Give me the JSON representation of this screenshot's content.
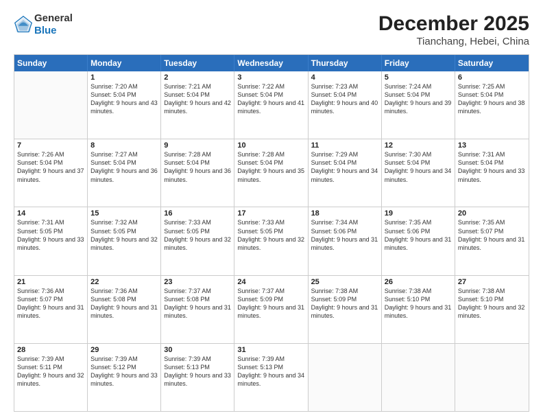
{
  "header": {
    "logo_line1": "General",
    "logo_line2": "Blue",
    "title": "December 2025",
    "subtitle": "Tianchang, Hebei, China"
  },
  "weekdays": [
    "Sunday",
    "Monday",
    "Tuesday",
    "Wednesday",
    "Thursday",
    "Friday",
    "Saturday"
  ],
  "weeks": [
    [
      {
        "day": "",
        "sunrise": "",
        "sunset": "",
        "daylight": ""
      },
      {
        "day": "1",
        "sunrise": "Sunrise: 7:20 AM",
        "sunset": "Sunset: 5:04 PM",
        "daylight": "Daylight: 9 hours and 43 minutes."
      },
      {
        "day": "2",
        "sunrise": "Sunrise: 7:21 AM",
        "sunset": "Sunset: 5:04 PM",
        "daylight": "Daylight: 9 hours and 42 minutes."
      },
      {
        "day": "3",
        "sunrise": "Sunrise: 7:22 AM",
        "sunset": "Sunset: 5:04 PM",
        "daylight": "Daylight: 9 hours and 41 minutes."
      },
      {
        "day": "4",
        "sunrise": "Sunrise: 7:23 AM",
        "sunset": "Sunset: 5:04 PM",
        "daylight": "Daylight: 9 hours and 40 minutes."
      },
      {
        "day": "5",
        "sunrise": "Sunrise: 7:24 AM",
        "sunset": "Sunset: 5:04 PM",
        "daylight": "Daylight: 9 hours and 39 minutes."
      },
      {
        "day": "6",
        "sunrise": "Sunrise: 7:25 AM",
        "sunset": "Sunset: 5:04 PM",
        "daylight": "Daylight: 9 hours and 38 minutes."
      }
    ],
    [
      {
        "day": "7",
        "sunrise": "Sunrise: 7:26 AM",
        "sunset": "Sunset: 5:04 PM",
        "daylight": "Daylight: 9 hours and 37 minutes."
      },
      {
        "day": "8",
        "sunrise": "Sunrise: 7:27 AM",
        "sunset": "Sunset: 5:04 PM",
        "daylight": "Daylight: 9 hours and 36 minutes."
      },
      {
        "day": "9",
        "sunrise": "Sunrise: 7:28 AM",
        "sunset": "Sunset: 5:04 PM",
        "daylight": "Daylight: 9 hours and 36 minutes."
      },
      {
        "day": "10",
        "sunrise": "Sunrise: 7:28 AM",
        "sunset": "Sunset: 5:04 PM",
        "daylight": "Daylight: 9 hours and 35 minutes."
      },
      {
        "day": "11",
        "sunrise": "Sunrise: 7:29 AM",
        "sunset": "Sunset: 5:04 PM",
        "daylight": "Daylight: 9 hours and 34 minutes."
      },
      {
        "day": "12",
        "sunrise": "Sunrise: 7:30 AM",
        "sunset": "Sunset: 5:04 PM",
        "daylight": "Daylight: 9 hours and 34 minutes."
      },
      {
        "day": "13",
        "sunrise": "Sunrise: 7:31 AM",
        "sunset": "Sunset: 5:04 PM",
        "daylight": "Daylight: 9 hours and 33 minutes."
      }
    ],
    [
      {
        "day": "14",
        "sunrise": "Sunrise: 7:31 AM",
        "sunset": "Sunset: 5:05 PM",
        "daylight": "Daylight: 9 hours and 33 minutes."
      },
      {
        "day": "15",
        "sunrise": "Sunrise: 7:32 AM",
        "sunset": "Sunset: 5:05 PM",
        "daylight": "Daylight: 9 hours and 32 minutes."
      },
      {
        "day": "16",
        "sunrise": "Sunrise: 7:33 AM",
        "sunset": "Sunset: 5:05 PM",
        "daylight": "Daylight: 9 hours and 32 minutes."
      },
      {
        "day": "17",
        "sunrise": "Sunrise: 7:33 AM",
        "sunset": "Sunset: 5:05 PM",
        "daylight": "Daylight: 9 hours and 32 minutes."
      },
      {
        "day": "18",
        "sunrise": "Sunrise: 7:34 AM",
        "sunset": "Sunset: 5:06 PM",
        "daylight": "Daylight: 9 hours and 31 minutes."
      },
      {
        "day": "19",
        "sunrise": "Sunrise: 7:35 AM",
        "sunset": "Sunset: 5:06 PM",
        "daylight": "Daylight: 9 hours and 31 minutes."
      },
      {
        "day": "20",
        "sunrise": "Sunrise: 7:35 AM",
        "sunset": "Sunset: 5:07 PM",
        "daylight": "Daylight: 9 hours and 31 minutes."
      }
    ],
    [
      {
        "day": "21",
        "sunrise": "Sunrise: 7:36 AM",
        "sunset": "Sunset: 5:07 PM",
        "daylight": "Daylight: 9 hours and 31 minutes."
      },
      {
        "day": "22",
        "sunrise": "Sunrise: 7:36 AM",
        "sunset": "Sunset: 5:08 PM",
        "daylight": "Daylight: 9 hours and 31 minutes."
      },
      {
        "day": "23",
        "sunrise": "Sunrise: 7:37 AM",
        "sunset": "Sunset: 5:08 PM",
        "daylight": "Daylight: 9 hours and 31 minutes."
      },
      {
        "day": "24",
        "sunrise": "Sunrise: 7:37 AM",
        "sunset": "Sunset: 5:09 PM",
        "daylight": "Daylight: 9 hours and 31 minutes."
      },
      {
        "day": "25",
        "sunrise": "Sunrise: 7:38 AM",
        "sunset": "Sunset: 5:09 PM",
        "daylight": "Daylight: 9 hours and 31 minutes."
      },
      {
        "day": "26",
        "sunrise": "Sunrise: 7:38 AM",
        "sunset": "Sunset: 5:10 PM",
        "daylight": "Daylight: 9 hours and 31 minutes."
      },
      {
        "day": "27",
        "sunrise": "Sunrise: 7:38 AM",
        "sunset": "Sunset: 5:10 PM",
        "daylight": "Daylight: 9 hours and 32 minutes."
      }
    ],
    [
      {
        "day": "28",
        "sunrise": "Sunrise: 7:39 AM",
        "sunset": "Sunset: 5:11 PM",
        "daylight": "Daylight: 9 hours and 32 minutes."
      },
      {
        "day": "29",
        "sunrise": "Sunrise: 7:39 AM",
        "sunset": "Sunset: 5:12 PM",
        "daylight": "Daylight: 9 hours and 33 minutes."
      },
      {
        "day": "30",
        "sunrise": "Sunrise: 7:39 AM",
        "sunset": "Sunset: 5:13 PM",
        "daylight": "Daylight: 9 hours and 33 minutes."
      },
      {
        "day": "31",
        "sunrise": "Sunrise: 7:39 AM",
        "sunset": "Sunset: 5:13 PM",
        "daylight": "Daylight: 9 hours and 34 minutes."
      },
      {
        "day": "",
        "sunrise": "",
        "sunset": "",
        "daylight": ""
      },
      {
        "day": "",
        "sunrise": "",
        "sunset": "",
        "daylight": ""
      },
      {
        "day": "",
        "sunrise": "",
        "sunset": "",
        "daylight": ""
      }
    ]
  ]
}
